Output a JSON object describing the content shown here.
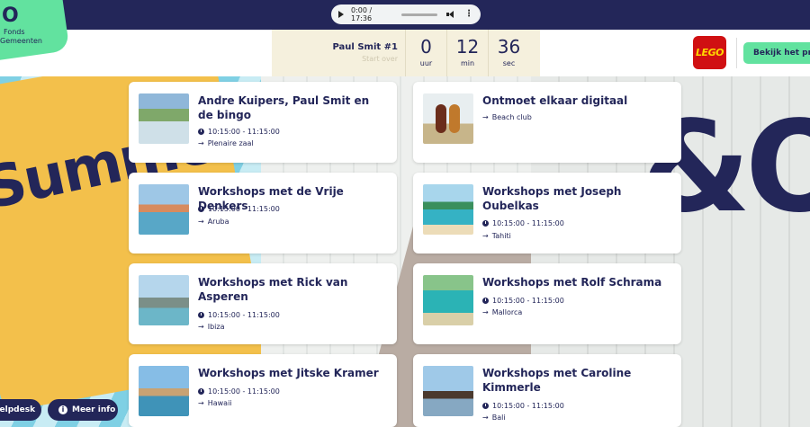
{
  "audio": {
    "time": "0:00 / 17:36"
  },
  "logo": {
    "mark": "O",
    "line1": "Fonds",
    "line2": "Gemeenten"
  },
  "countdown": {
    "title": "Paul Smit #1",
    "subtitle": "Start over",
    "units": [
      {
        "value": "0",
        "label": "uur"
      },
      {
        "value": "12",
        "label": "min"
      },
      {
        "value": "36",
        "label": "sec"
      }
    ]
  },
  "brand": {
    "lego": "LEGO"
  },
  "header": {
    "program_button": "Bekijk het programma"
  },
  "background": {
    "summer": "Summer School",
    "amp": "&O"
  },
  "sessions": [
    {
      "title": "Andre Kuipers, Paul Smit en de bingo",
      "time": "10:15:00 - 11:15:00",
      "location": "Plenaire zaal"
    },
    {
      "title": "Ontmoet elkaar digitaal",
      "location": "Beach club"
    },
    {
      "title": "Workshops met de Vrije Denkers",
      "time": "10:15:00 - 11:15:00",
      "location": "Aruba"
    },
    {
      "title": "Workshops met Joseph Oubelkas",
      "time": "10:15:00 - 11:15:00",
      "location": "Tahiti"
    },
    {
      "title": "Workshops met Rick van Asperen",
      "time": "10:15:00 - 11:15:00",
      "location": "Ibiza"
    },
    {
      "title": "Workshops met Rolf Schrama",
      "time": "10:15:00 - 11:15:00",
      "location": "Mallorca"
    },
    {
      "title": "Workshops met Jitske Kramer",
      "time": "10:15:00 - 11:15:00",
      "location": "Hawaii"
    },
    {
      "title": "Workshops met Caroline Kimmerle",
      "time": "10:15:00 - 11:15:00",
      "location": "Bali"
    }
  ],
  "footer": {
    "helpdesk": "Helpdesk",
    "info": "Meer info"
  }
}
